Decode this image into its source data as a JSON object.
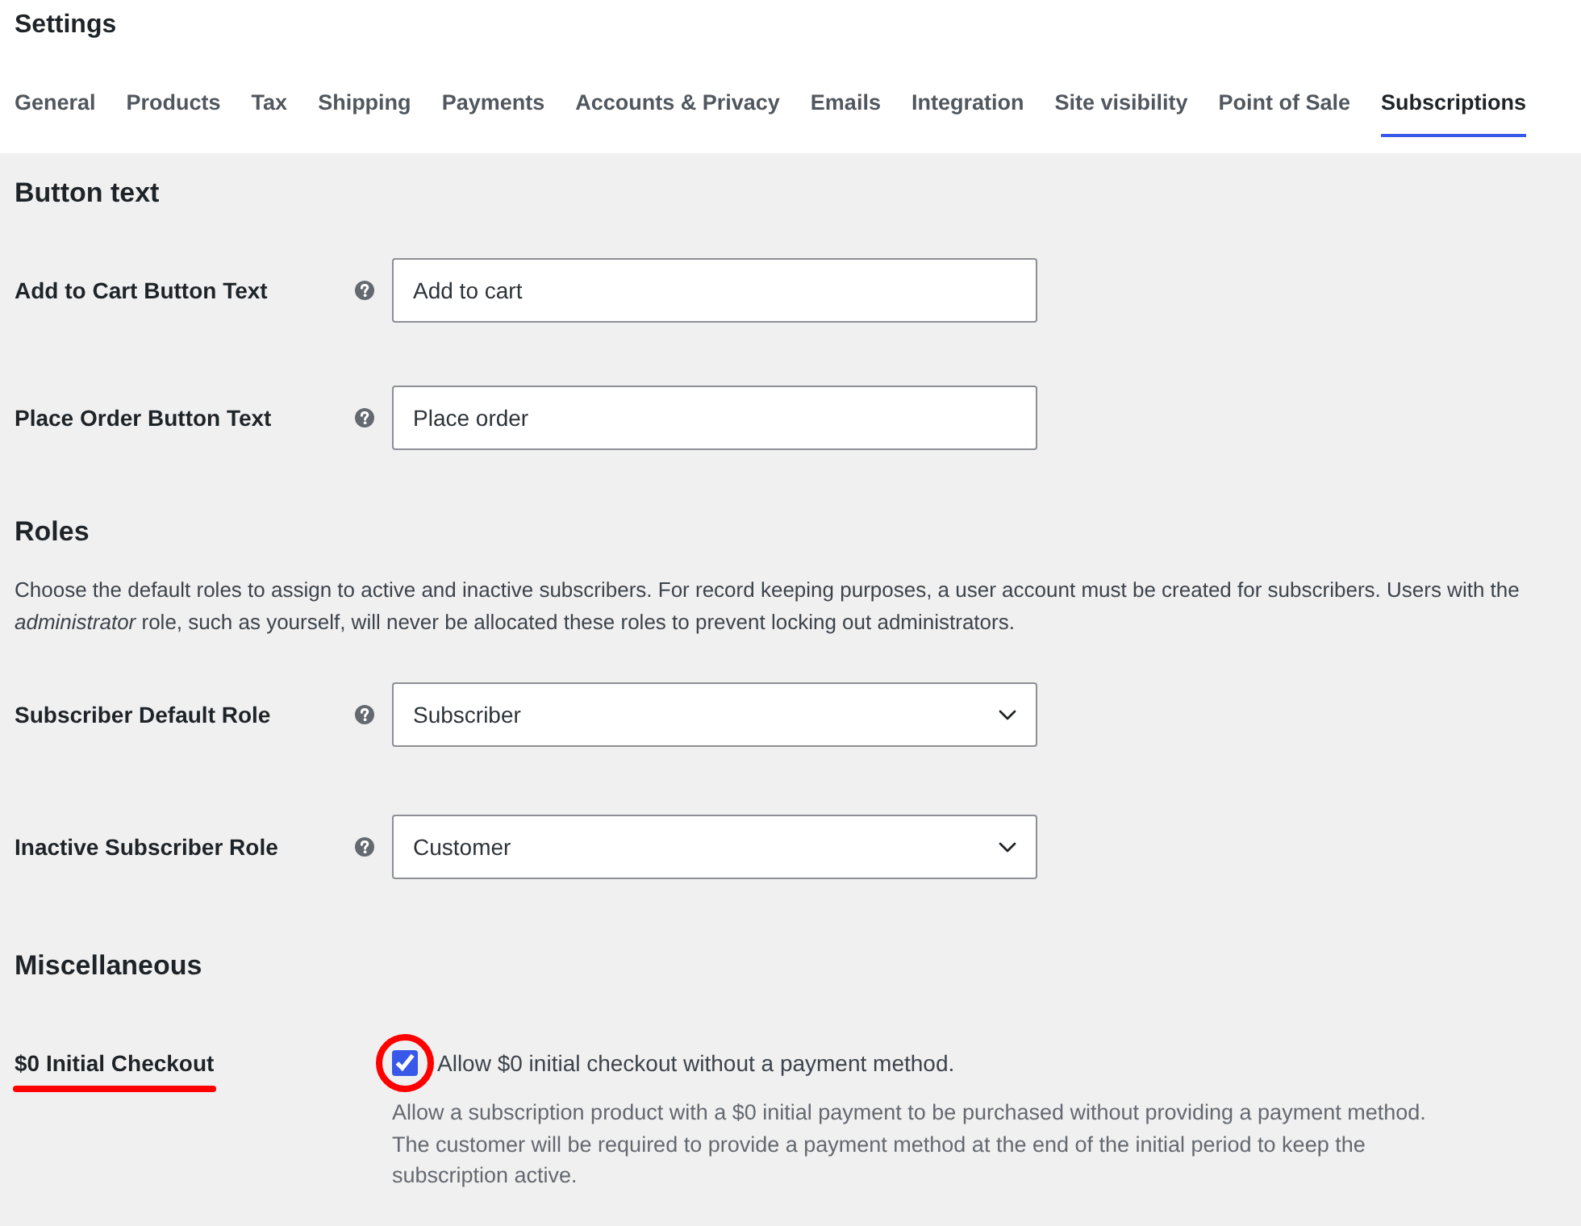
{
  "page": {
    "title": "Settings"
  },
  "tabs": [
    {
      "label": "General",
      "selected": false
    },
    {
      "label": "Products",
      "selected": false
    },
    {
      "label": "Tax",
      "selected": false
    },
    {
      "label": "Shipping",
      "selected": false
    },
    {
      "label": "Payments",
      "selected": false
    },
    {
      "label": "Accounts & Privacy",
      "selected": false
    },
    {
      "label": "Emails",
      "selected": false
    },
    {
      "label": "Integration",
      "selected": false
    },
    {
      "label": "Site visibility",
      "selected": false
    },
    {
      "label": "Point of Sale",
      "selected": false
    },
    {
      "label": "Subscriptions",
      "selected": true
    }
  ],
  "sections": [
    {
      "heading": "Button text",
      "settings": [
        {
          "kind": "text",
          "label": "Add to Cart Button Text",
          "help": true,
          "value": "Add to cart"
        },
        {
          "kind": "text",
          "label": "Place Order Button Text",
          "help": true,
          "value": "Place order"
        }
      ]
    },
    {
      "heading": "Roles",
      "description": "Choose the default roles to assign to active and inactive subscribers. For record keeping purposes, a user account must be created for subscribers. Users with the *administrator* role, such as yourself, will never be allocated these roles to prevent locking out administrators.",
      "settings": [
        {
          "kind": "select",
          "label": "Subscriber Default Role",
          "help": true,
          "value": "Subscriber"
        },
        {
          "kind": "select",
          "label": "Inactive Subscriber Role",
          "help": true,
          "value": "Customer"
        }
      ]
    },
    {
      "heading": "Miscellaneous",
      "settings": [
        {
          "kind": "checkbox",
          "label": "$0 Initial Checkout",
          "highlight": true,
          "checked": true,
          "option": "Allow $0 initial checkout without a payment method.",
          "description": "Allow a subscription product with a $0 initial payment to be purchased without providing a payment method. The customer will be required to provide a payment method at the end of the initial period to keep the subscription active."
        }
      ]
    }
  ]
}
